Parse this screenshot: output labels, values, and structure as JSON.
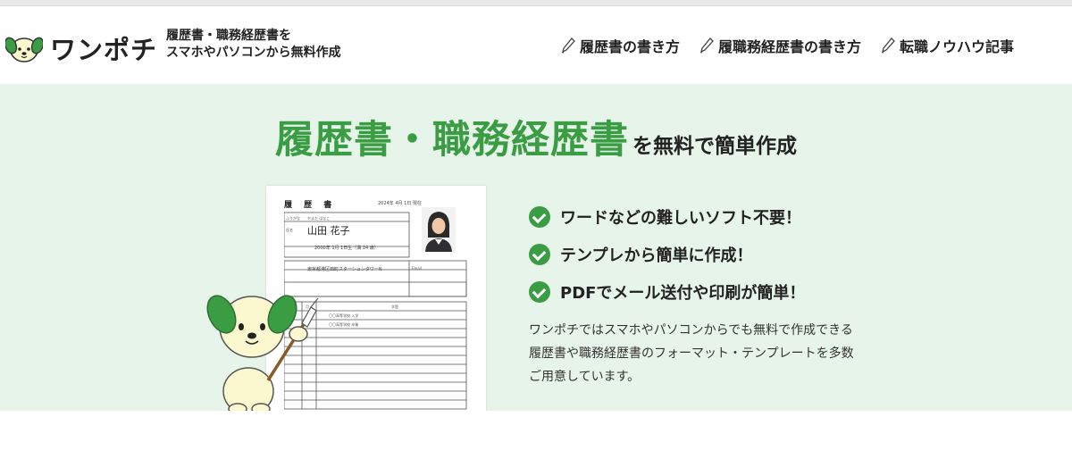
{
  "header": {
    "brand": "ワンポチ",
    "tagline_line1": "履歴書・職務経歴書を",
    "tagline_line2": "スマホやパソコンから無料作成",
    "nav": [
      {
        "label": "履歴書の書き方",
        "icon": "pen-icon"
      },
      {
        "label": "履職務経歴書の書き方",
        "icon": "pen-icon"
      },
      {
        "label": "転職ノウハウ記事",
        "icon": "pen-icon"
      }
    ]
  },
  "hero": {
    "title_main": "履歴書・職務経歴書",
    "title_suffix": "を無料で簡単作成",
    "resume": {
      "title": "履 歴 書",
      "date": "2024年 4月 1日 現在",
      "furigana_label": "ふりがな",
      "furigana": "やまだ はなこ",
      "name_label": "氏名",
      "name": "山田 花子",
      "birth": "2000年 1月 1日生（満 24 歳）",
      "address": "東京都港区田町スターションタワーN",
      "email_label": "Email",
      "history_header_year": "年",
      "history_header_month": "月",
      "history_header_item": "学歴",
      "history_row1": "〇〇高等学校 入学",
      "history_row2": "〇〇高等学校 卒業"
    },
    "features": [
      "ワードなどの難しいソフト不要！",
      "テンプレから簡単に作成！",
      "PDFでメール送付や印刷が簡単！"
    ],
    "description": [
      "ワンポチではスマホやパソコンからでも無料で作成できる",
      "履歴書や職務経歴書のフォーマット・テンプレートを多数",
      "ご用意しています。"
    ]
  },
  "colors": {
    "accent_green": "#3a9d44",
    "hero_bg": "#e7f4e9",
    "dog_body": "#fbf7cf",
    "dog_ear": "#3a9d44"
  }
}
